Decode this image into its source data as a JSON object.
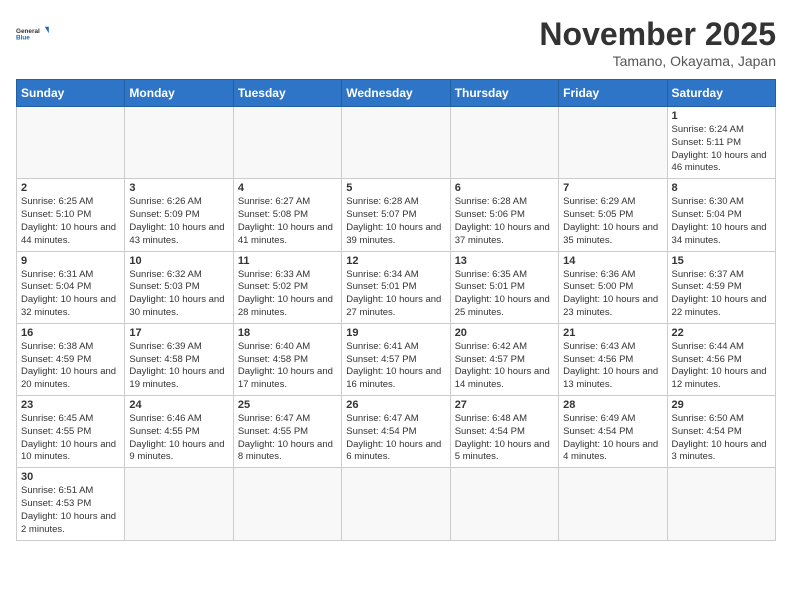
{
  "logo": {
    "text_general": "General",
    "text_blue": "Blue"
  },
  "title": "November 2025",
  "location": "Tamano, Okayama, Japan",
  "weekdays": [
    "Sunday",
    "Monday",
    "Tuesday",
    "Wednesday",
    "Thursday",
    "Friday",
    "Saturday"
  ],
  "weeks": [
    [
      {
        "day": "",
        "info": ""
      },
      {
        "day": "",
        "info": ""
      },
      {
        "day": "",
        "info": ""
      },
      {
        "day": "",
        "info": ""
      },
      {
        "day": "",
        "info": ""
      },
      {
        "day": "",
        "info": ""
      },
      {
        "day": "1",
        "info": "Sunrise: 6:24 AM\nSunset: 5:11 PM\nDaylight: 10 hours and 46 minutes."
      }
    ],
    [
      {
        "day": "2",
        "info": "Sunrise: 6:25 AM\nSunset: 5:10 PM\nDaylight: 10 hours and 44 minutes."
      },
      {
        "day": "3",
        "info": "Sunrise: 6:26 AM\nSunset: 5:09 PM\nDaylight: 10 hours and 43 minutes."
      },
      {
        "day": "4",
        "info": "Sunrise: 6:27 AM\nSunset: 5:08 PM\nDaylight: 10 hours and 41 minutes."
      },
      {
        "day": "5",
        "info": "Sunrise: 6:28 AM\nSunset: 5:07 PM\nDaylight: 10 hours and 39 minutes."
      },
      {
        "day": "6",
        "info": "Sunrise: 6:28 AM\nSunset: 5:06 PM\nDaylight: 10 hours and 37 minutes."
      },
      {
        "day": "7",
        "info": "Sunrise: 6:29 AM\nSunset: 5:05 PM\nDaylight: 10 hours and 35 minutes."
      },
      {
        "day": "8",
        "info": "Sunrise: 6:30 AM\nSunset: 5:04 PM\nDaylight: 10 hours and 34 minutes."
      }
    ],
    [
      {
        "day": "9",
        "info": "Sunrise: 6:31 AM\nSunset: 5:04 PM\nDaylight: 10 hours and 32 minutes."
      },
      {
        "day": "10",
        "info": "Sunrise: 6:32 AM\nSunset: 5:03 PM\nDaylight: 10 hours and 30 minutes."
      },
      {
        "day": "11",
        "info": "Sunrise: 6:33 AM\nSunset: 5:02 PM\nDaylight: 10 hours and 28 minutes."
      },
      {
        "day": "12",
        "info": "Sunrise: 6:34 AM\nSunset: 5:01 PM\nDaylight: 10 hours and 27 minutes."
      },
      {
        "day": "13",
        "info": "Sunrise: 6:35 AM\nSunset: 5:01 PM\nDaylight: 10 hours and 25 minutes."
      },
      {
        "day": "14",
        "info": "Sunrise: 6:36 AM\nSunset: 5:00 PM\nDaylight: 10 hours and 23 minutes."
      },
      {
        "day": "15",
        "info": "Sunrise: 6:37 AM\nSunset: 4:59 PM\nDaylight: 10 hours and 22 minutes."
      }
    ],
    [
      {
        "day": "16",
        "info": "Sunrise: 6:38 AM\nSunset: 4:59 PM\nDaylight: 10 hours and 20 minutes."
      },
      {
        "day": "17",
        "info": "Sunrise: 6:39 AM\nSunset: 4:58 PM\nDaylight: 10 hours and 19 minutes."
      },
      {
        "day": "18",
        "info": "Sunrise: 6:40 AM\nSunset: 4:58 PM\nDaylight: 10 hours and 17 minutes."
      },
      {
        "day": "19",
        "info": "Sunrise: 6:41 AM\nSunset: 4:57 PM\nDaylight: 10 hours and 16 minutes."
      },
      {
        "day": "20",
        "info": "Sunrise: 6:42 AM\nSunset: 4:57 PM\nDaylight: 10 hours and 14 minutes."
      },
      {
        "day": "21",
        "info": "Sunrise: 6:43 AM\nSunset: 4:56 PM\nDaylight: 10 hours and 13 minutes."
      },
      {
        "day": "22",
        "info": "Sunrise: 6:44 AM\nSunset: 4:56 PM\nDaylight: 10 hours and 12 minutes."
      }
    ],
    [
      {
        "day": "23",
        "info": "Sunrise: 6:45 AM\nSunset: 4:55 PM\nDaylight: 10 hours and 10 minutes."
      },
      {
        "day": "24",
        "info": "Sunrise: 6:46 AM\nSunset: 4:55 PM\nDaylight: 10 hours and 9 minutes."
      },
      {
        "day": "25",
        "info": "Sunrise: 6:47 AM\nSunset: 4:55 PM\nDaylight: 10 hours and 8 minutes."
      },
      {
        "day": "26",
        "info": "Sunrise: 6:47 AM\nSunset: 4:54 PM\nDaylight: 10 hours and 6 minutes."
      },
      {
        "day": "27",
        "info": "Sunrise: 6:48 AM\nSunset: 4:54 PM\nDaylight: 10 hours and 5 minutes."
      },
      {
        "day": "28",
        "info": "Sunrise: 6:49 AM\nSunset: 4:54 PM\nDaylight: 10 hours and 4 minutes."
      },
      {
        "day": "29",
        "info": "Sunrise: 6:50 AM\nSunset: 4:54 PM\nDaylight: 10 hours and 3 minutes."
      }
    ],
    [
      {
        "day": "30",
        "info": "Sunrise: 6:51 AM\nSunset: 4:53 PM\nDaylight: 10 hours and 2 minutes."
      },
      {
        "day": "",
        "info": ""
      },
      {
        "day": "",
        "info": ""
      },
      {
        "day": "",
        "info": ""
      },
      {
        "day": "",
        "info": ""
      },
      {
        "day": "",
        "info": ""
      },
      {
        "day": "",
        "info": ""
      }
    ]
  ]
}
